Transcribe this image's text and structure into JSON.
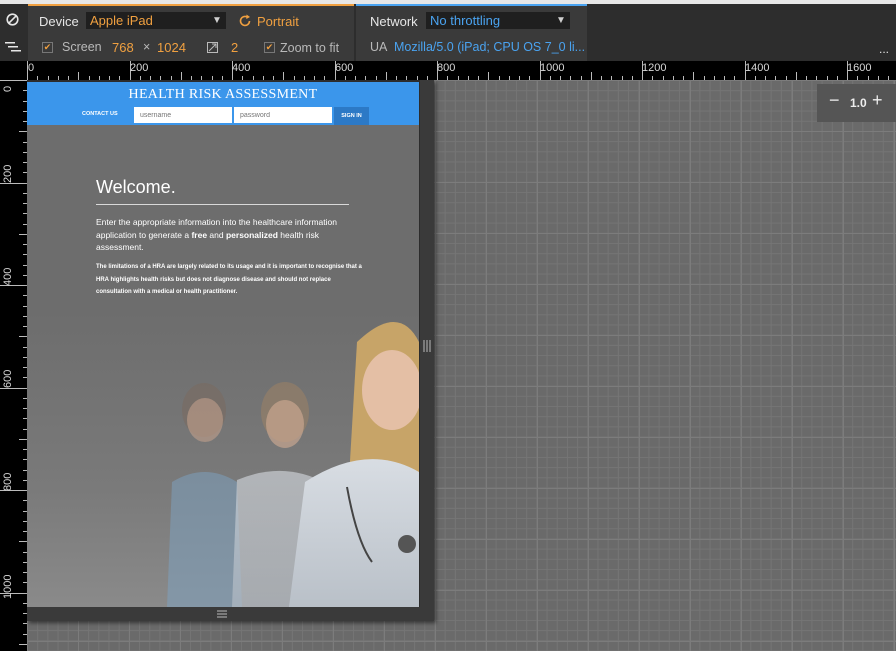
{
  "toolbar": {
    "device_label": "Device",
    "device_value": "Apple iPad",
    "rotate_label": "Portrait",
    "screen_label": "Screen",
    "screen_width": "768",
    "times": "×",
    "screen_height": "1024",
    "dpr_value": "2",
    "zoom_to_fit_label": "Zoom to fit",
    "network_label": "Network",
    "network_value": "No throttling",
    "ua_label": "UA",
    "ua_value": "Mozilla/5.0 (iPad; CPU OS 7_0 li...",
    "more": "..."
  },
  "ruler": {
    "h_labels": [
      "0",
      "200",
      "400",
      "600",
      "800",
      "1000",
      "1200",
      "1400",
      "1600"
    ],
    "v_labels": [
      "0",
      "200",
      "400",
      "600",
      "800",
      "1000"
    ]
  },
  "zoom": {
    "minus": "−",
    "value": "1.0",
    "plus": "+"
  },
  "site": {
    "title": "HEALTH RISK ASSESSMENT",
    "contact_us": "CONTACT US",
    "username_placeholder": "username",
    "password_placeholder": "password",
    "sign_in": "SIGN IN",
    "welcome": "Welcome.",
    "intro_part1": "Enter the appropriate information into the healthcare information application to generate a ",
    "intro_free": "free",
    "intro_and": " and ",
    "intro_personalized": "personalized",
    "intro_part2": " health risk assessment.",
    "disclaimer": "The limitations of a HRA are largely related to its usage and it is important to recognise that a HRA highlights health risks but does not diagnose disease and should not replace consultation with a medical or health practitioner."
  },
  "colors": {
    "accent_orange": "#f0a040",
    "accent_blue": "#4aa3f0",
    "site_header": "#3b96eb"
  }
}
